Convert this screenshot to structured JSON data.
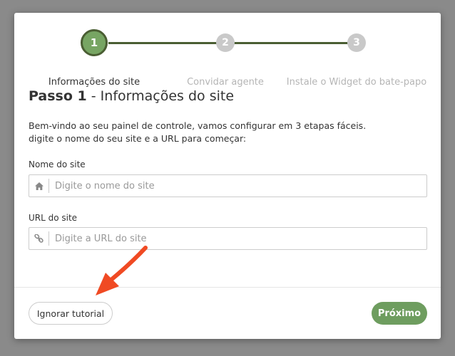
{
  "stepper": {
    "steps": [
      {
        "number": "1",
        "label": "Informações do site",
        "state": "active"
      },
      {
        "number": "2",
        "label": "Convidar agente",
        "state": "pending"
      },
      {
        "number": "3",
        "label": "Instale o Widget do bate-papo",
        "state": "pending"
      }
    ]
  },
  "title": {
    "step": "Passo 1",
    "rest": " - Informações do site"
  },
  "description": {
    "line1": "Bem-vindo ao seu painel de controle, vamos configurar em 3 etapas fáceis.",
    "line2": "digite o nome do seu site e a URL para começar:"
  },
  "fields": {
    "site_name": {
      "label": "Nome do site",
      "value": "",
      "placeholder": "Digite o nome do site",
      "icon": "home-icon"
    },
    "site_url": {
      "label": "URL do site",
      "value": "",
      "placeholder": "Digite a URL do site",
      "icon": "link-icon"
    }
  },
  "footer": {
    "skip_label": "Ignorar tutorial",
    "next_label": "Próximo"
  },
  "colors": {
    "accent_green": "#6e9d5f",
    "stepper_dark_green": "#4a5e33",
    "annotation_arrow": "#f04a23"
  }
}
